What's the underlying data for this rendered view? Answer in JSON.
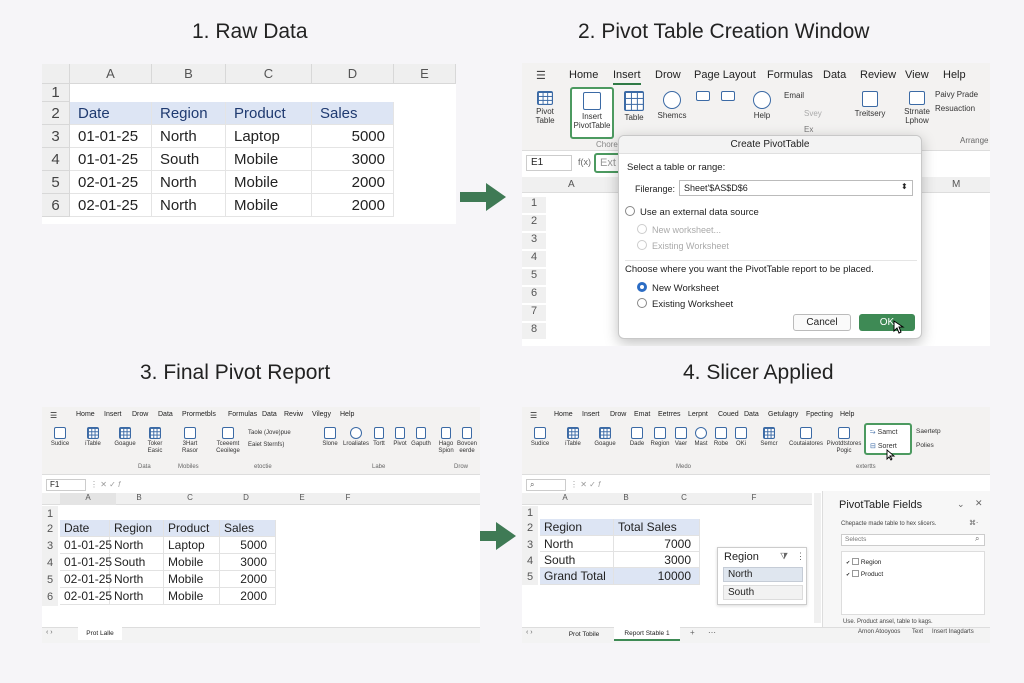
{
  "titles": {
    "t1": "1. Raw Data",
    "t2a": "2. Pivot Table",
    "t2b": " Creation Window",
    "t3": "3. Final Pivot Report",
    "t4": "4. Slicer Applied"
  },
  "raw": {
    "cols": [
      "A",
      "B",
      "C",
      "D",
      "E"
    ],
    "rows": [
      "1",
      "2",
      "3",
      "4",
      "5",
      "6"
    ],
    "headers": [
      "Date",
      "Region",
      "Product",
      "Sales"
    ],
    "data": [
      [
        "01-01-25",
        "North",
        "Laptop",
        "5000"
      ],
      [
        "01-01-25",
        "South",
        "Mobile",
        "3000"
      ],
      [
        "02-01-25",
        "North",
        "Mobile",
        "2000"
      ],
      [
        "02-01-25",
        "North",
        "Mobile",
        "2000"
      ]
    ]
  },
  "p2": {
    "tabs": [
      "Home",
      "Insert",
      "Drow",
      "Page Layout",
      "Formulas",
      "Data",
      "Review",
      "View",
      "Help"
    ],
    "ribbon": {
      "pivot": "Pivot Table",
      "insert_pivot": "Insert PivotTable",
      "table": "Table",
      "shapes": "Shemcs",
      "help": "Help",
      "email": "Email",
      "svey": "Svey",
      "ex": "Ex",
      "treitsery": "Treitsery",
      "strnate": "Strnate Lphow",
      "paivy": "Paivy Prade",
      "resuaction": "Resuaction",
      "arrange": "Arrange",
      "chore": "Chore"
    },
    "namebox": "E1",
    "formula_prefix": "f(x)",
    "formula_text": "Ext",
    "cols": [
      "A",
      "M"
    ],
    "rows": [
      "1",
      "2",
      "3",
      "4",
      "5",
      "6",
      "7",
      "8"
    ],
    "dialog": {
      "title": "Create PivotTable",
      "select": "Select a table or range:",
      "range_label": "Filerange:",
      "range_value": "Sheet'$AS$D$6",
      "external": "Use an external data source",
      "new_ws_dim": "New worksheet...",
      "exist_ws_dim": "Existing Worksheet",
      "choose": "Choose where you want the PivotTable report to be placed.",
      "new_ws": "New Worksheet",
      "exist_ws": "Existing Worksheet",
      "cancel": "Cancel",
      "ok": "OK"
    }
  },
  "p3": {
    "tabs": [
      "Home",
      "Insert",
      "Drow",
      "Data",
      "Prormetbls",
      "Formulas",
      "Data",
      "Reviw",
      "Vilegy",
      "Help"
    ],
    "ribbon": [
      "Sudice",
      "iTable",
      "Goague",
      "Toker Easic",
      "3Hart Rasor",
      "Tceeemt Ceoilege",
      "Taole (Jove)pue",
      "Eaiet Sternfs)",
      "Slone",
      "Lroaliates",
      "Tortt",
      "Pivot",
      "Gaputh",
      "Hago Spion",
      "Bovcen eerde"
    ],
    "groups": [
      "Data",
      "Mobiles",
      "etoctie",
      "Labe",
      "Drow"
    ],
    "namebox": "F1",
    "cols": [
      "A",
      "B",
      "C",
      "D",
      "E",
      "F"
    ],
    "rows": [
      "1",
      "2",
      "3",
      "4",
      "5",
      "6"
    ],
    "headers": [
      "Date",
      "Region",
      "Product",
      "Sales"
    ],
    "data": [
      [
        "01-01-25",
        "North",
        "Laptop",
        "5000"
      ],
      [
        "01-01-25",
        "South",
        "Mobile",
        "3000"
      ],
      [
        "02-01-25",
        "North",
        "Mobile",
        "2000"
      ],
      [
        "02-01-25",
        "North",
        "Mobile",
        "2000"
      ]
    ],
    "sheet_tab": "Prot Lalle"
  },
  "p4": {
    "tabs": [
      "Home",
      "Insert",
      "Drow",
      "Emat",
      "Eetrres",
      "Lerpnt",
      "Coued",
      "Data",
      "Getulagry",
      "Fpecting",
      "Help"
    ],
    "ribbon": [
      "Sudice",
      "iTable",
      "Goague",
      "Dade",
      "Region",
      "Vaer",
      "Mast",
      "Robe",
      "OKi",
      "Semcr",
      "Coutaiatores",
      "Pivotdtstores Pogic",
      "Samct",
      "Sorert",
      "Saertetp",
      "Polies"
    ],
    "groups": [
      "Medo",
      "extertts"
    ],
    "cols": [
      "A",
      "B",
      "C",
      "F"
    ],
    "rows": [
      "1",
      "2",
      "3",
      "4",
      "5"
    ],
    "pivot": {
      "h1": "Region",
      "h2": "Total Sales",
      "rows": [
        [
          "North",
          "7000"
        ],
        [
          "South",
          "3000"
        ]
      ],
      "total_label": "Grand Total",
      "total": "10000"
    },
    "slicer": {
      "title": "Region",
      "items": [
        "North",
        "South"
      ]
    },
    "fields": {
      "title": "PivotTable Fields",
      "hint": "Chepacte made table to hex slicers.",
      "search": "Selects",
      "items": [
        "Region",
        "Product"
      ],
      "footer": "Use. Product ansel, table to kags."
    },
    "sheet_tabs": [
      "Prot Tobile",
      "Report Stable 1"
    ],
    "status": [
      "Arnon Atooyoos",
      "Text",
      "Insert Inagdarts"
    ]
  }
}
